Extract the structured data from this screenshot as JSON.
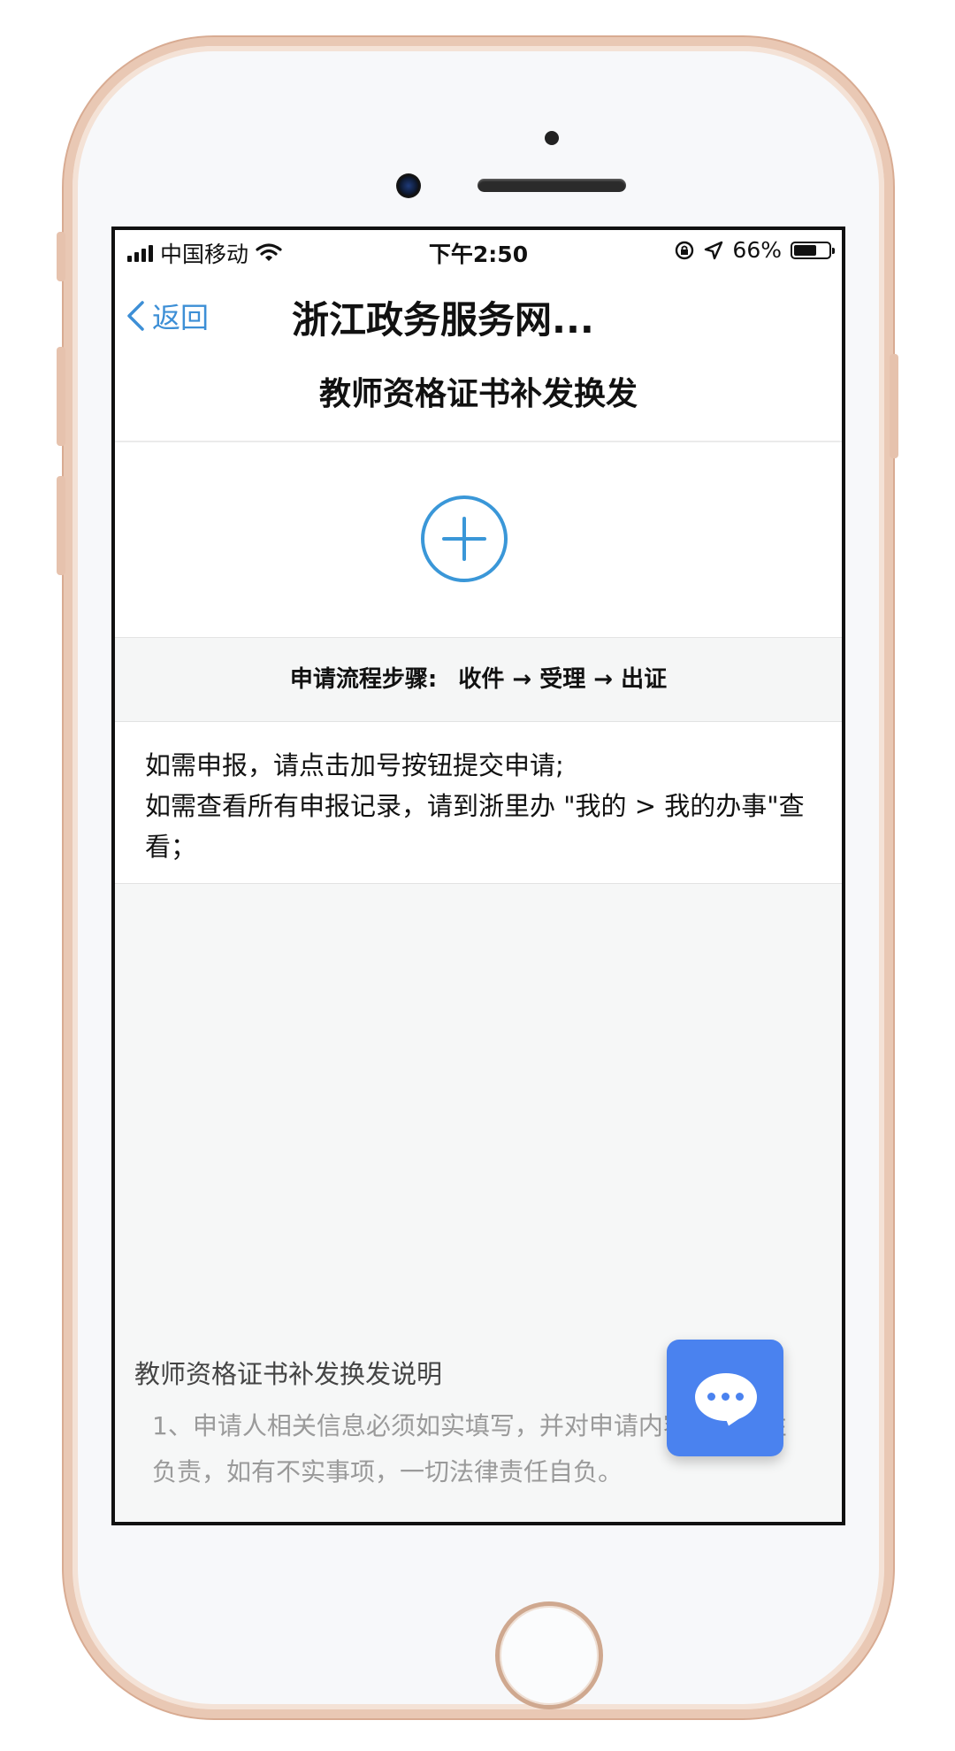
{
  "status_bar": {
    "carrier": "中国移动",
    "time": "下午2:50",
    "battery_percent": "66%",
    "battery_level": 0.66,
    "icons": [
      "signal-icon",
      "wifi-icon",
      "orientation-lock-icon",
      "location-icon",
      "battery-icon"
    ]
  },
  "nav": {
    "back_label": "返回",
    "title": "浙江政务服务网..."
  },
  "page": {
    "subtitle": "教师资格证书补发换发",
    "add_button_icon": "plus-circle-icon",
    "process_label": "申请流程步骤:",
    "process_steps": "收件 → 受理 → 出证",
    "notice_line1": "如需申报，请点击加号按钮提交申请;",
    "notice_line2": "如需查看所有申报记录，请到浙里办 \"我的 > 我的办事\"查看；",
    "desc_title": "教师资格证书补发换发说明",
    "desc_text": "1、申请人相关信息必须如实填写，并对申请内容的真实性负责，如有不实事项，一切法律责任自负。"
  },
  "chat": {
    "icon": "chat-bubble-icon"
  },
  "colors": {
    "accent_blue": "#3a97d8",
    "chat_blue": "#4a82ef",
    "back_blue": "#3d8fd6"
  }
}
